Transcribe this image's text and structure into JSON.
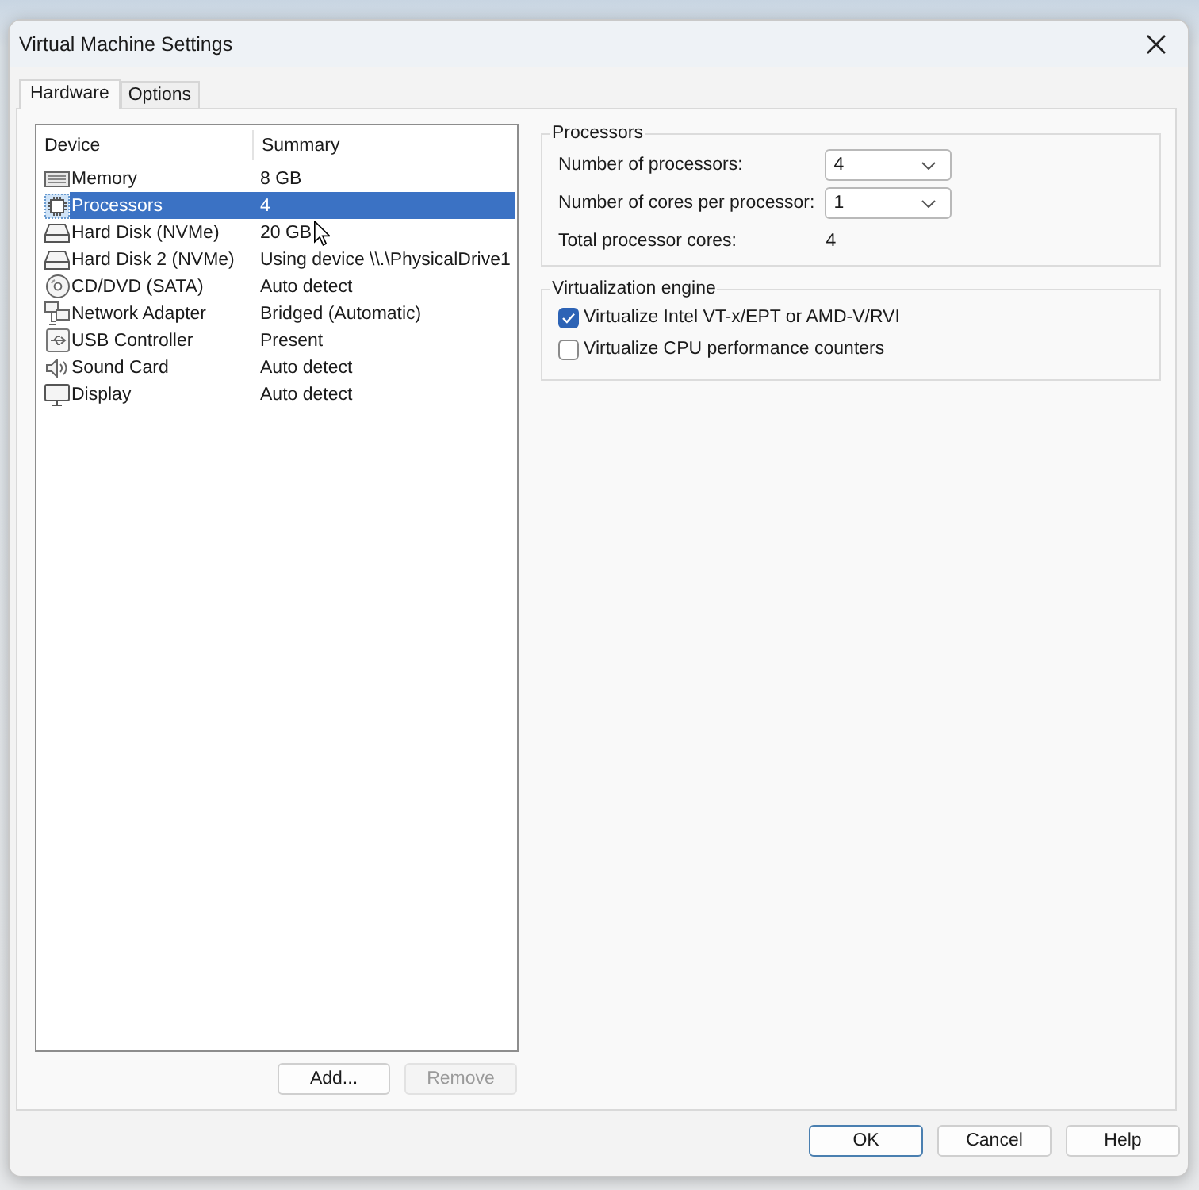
{
  "window": {
    "title": "Virtual Machine Settings"
  },
  "tabs": [
    {
      "label": "Hardware",
      "selected": true
    },
    {
      "label": "Options",
      "selected": false
    }
  ],
  "device_table": {
    "columns": [
      "Device",
      "Summary"
    ],
    "rows": [
      {
        "kind": "memory",
        "device": "Memory",
        "summary": "8 GB",
        "selected": false
      },
      {
        "kind": "processor",
        "device": "Processors",
        "summary": "4",
        "selected": true
      },
      {
        "kind": "hard_disk",
        "device": "Hard Disk (NVMe)",
        "summary": "20 GB",
        "selected": false
      },
      {
        "kind": "hard_disk",
        "device": "Hard Disk 2 (NVMe)",
        "summary": "Using device \\\\.\\PhysicalDrive1",
        "selected": false
      },
      {
        "kind": "cd_dvd",
        "device": "CD/DVD (SATA)",
        "summary": "Auto detect",
        "selected": false
      },
      {
        "kind": "network",
        "device": "Network Adapter",
        "summary": "Bridged (Automatic)",
        "selected": false
      },
      {
        "kind": "usb",
        "device": "USB Controller",
        "summary": "Present",
        "selected": false
      },
      {
        "kind": "sound",
        "device": "Sound Card",
        "summary": "Auto detect",
        "selected": false
      },
      {
        "kind": "display",
        "device": "Display",
        "summary": "Auto detect",
        "selected": false
      }
    ]
  },
  "device_buttons": [
    {
      "label": "Add...",
      "disabled": false
    },
    {
      "label": "Remove",
      "disabled": true
    }
  ],
  "processors": {
    "title": "Processors",
    "fields": [
      {
        "label": "Number of processors:",
        "value": "4"
      },
      {
        "label": "Number of cores per processor:",
        "value": "1"
      }
    ],
    "total": {
      "label": "Total processor cores:",
      "value": "4"
    }
  },
  "virtualization": {
    "title": "Virtualization engine",
    "options": [
      {
        "label": "Virtualize Intel VT-x/EPT or AMD-V/RVI",
        "checked": true
      },
      {
        "label": "Virtualize CPU performance counters",
        "checked": false
      }
    ]
  },
  "dialog_buttons": [
    {
      "label": "OK",
      "default": true
    },
    {
      "label": "Cancel",
      "default": false
    },
    {
      "label": "Help",
      "default": false
    }
  ]
}
